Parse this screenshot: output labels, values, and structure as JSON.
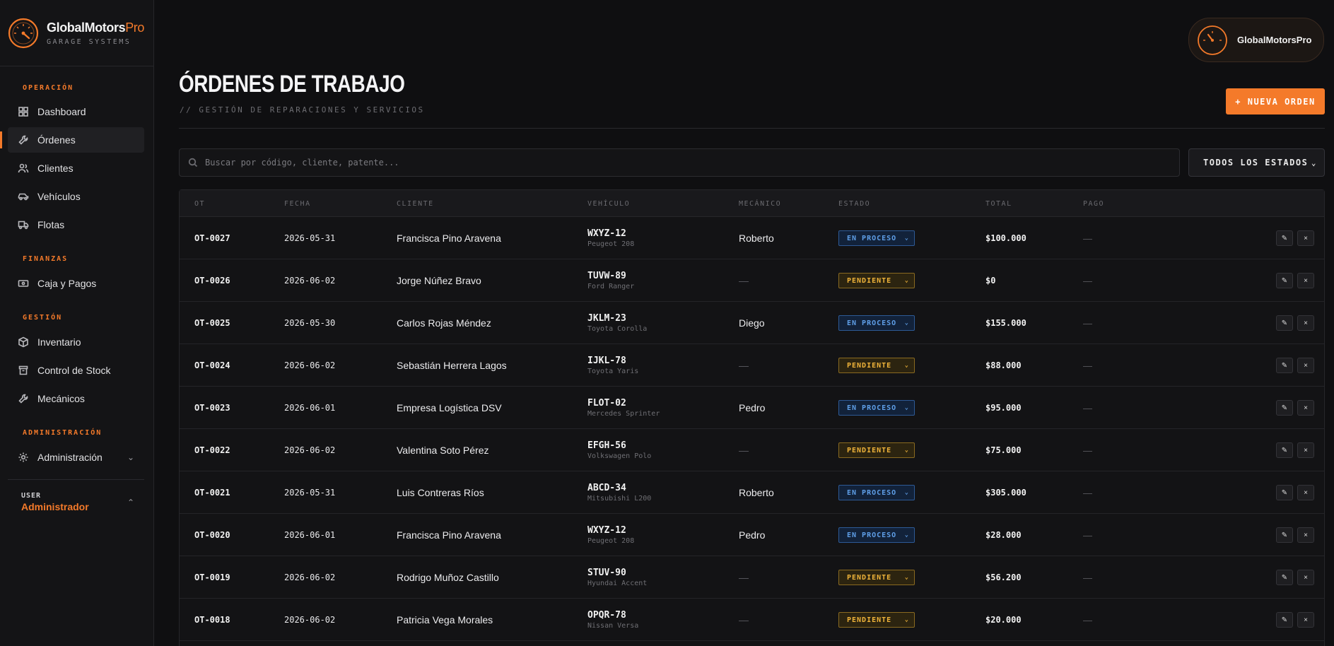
{
  "brand": {
    "name_main": "GlobalMotors",
    "name_accent": "Pro",
    "subtitle": "GARAGE SYSTEMS"
  },
  "sidebar": {
    "sections": {
      "operacion": "OPERACIÓN",
      "finanzas": "FINANZAS",
      "gestion": "GESTIÓN",
      "administracion": "ADMINISTRACIÓN"
    },
    "items": {
      "dashboard": "Dashboard",
      "ordenes": "Órdenes",
      "clientes": "Clientes",
      "vehiculos": "Vehículos",
      "flotas": "Flotas",
      "caja": "Caja y Pagos",
      "inventario": "Inventario",
      "stock": "Control de Stock",
      "mecanicos": "Mecánicos",
      "administracion": "Administración"
    },
    "user": {
      "label": "USER",
      "role": "Administrador"
    }
  },
  "topbar": {
    "profile_name": "GlobalMotorsPro"
  },
  "header": {
    "title": "ÓRDENES DE TRABAJO",
    "subtitle": "// GESTIÓN DE REPARACIONES Y SERVICIOS",
    "new_button": "+ NUEVA ORDEN"
  },
  "filters": {
    "search_placeholder": "Buscar por código, cliente, patente...",
    "status_select": "TODOS LOS ESTADOS"
  },
  "table": {
    "headers": {
      "ot": "OT",
      "fecha": "FECHA",
      "cliente": "CLIENTE",
      "vehiculo": "VEHÍCULO",
      "mecanico": "MECÁNICO",
      "estado": "ESTADO",
      "total": "TOTAL",
      "pago": "PAGO"
    },
    "rows": [
      {
        "ot": "OT-0027",
        "fecha": "2026-05-31",
        "cliente": "Francisca Pino Aravena",
        "patente": "WXYZ-12",
        "modelo": "Peugeot 208",
        "mecanico": "Roberto",
        "estado": "EN PROCESO",
        "total": "$100.000",
        "pago": "—"
      },
      {
        "ot": "OT-0026",
        "fecha": "2026-06-02",
        "cliente": "Jorge Núñez Bravo",
        "patente": "TUVW-89",
        "modelo": "Ford Ranger",
        "mecanico": "—",
        "estado": "PENDIENTE",
        "total": "$0",
        "pago": "—"
      },
      {
        "ot": "OT-0025",
        "fecha": "2026-05-30",
        "cliente": "Carlos Rojas Méndez",
        "patente": "JKLM-23",
        "modelo": "Toyota Corolla",
        "mecanico": "Diego",
        "estado": "EN PROCESO",
        "total": "$155.000",
        "pago": "—"
      },
      {
        "ot": "OT-0024",
        "fecha": "2026-06-02",
        "cliente": "Sebastián Herrera Lagos",
        "patente": "IJKL-78",
        "modelo": "Toyota Yaris",
        "mecanico": "—",
        "estado": "PENDIENTE",
        "total": "$88.000",
        "pago": "—"
      },
      {
        "ot": "OT-0023",
        "fecha": "2026-06-01",
        "cliente": "Empresa Logística DSV",
        "patente": "FLOT-02",
        "modelo": "Mercedes Sprinter",
        "mecanico": "Pedro",
        "estado": "EN PROCESO",
        "total": "$95.000",
        "pago": "—"
      },
      {
        "ot": "OT-0022",
        "fecha": "2026-06-02",
        "cliente": "Valentina Soto Pérez",
        "patente": "EFGH-56",
        "modelo": "Volkswagen Polo",
        "mecanico": "—",
        "estado": "PENDIENTE",
        "total": "$75.000",
        "pago": "—"
      },
      {
        "ot": "OT-0021",
        "fecha": "2026-05-31",
        "cliente": "Luis Contreras Ríos",
        "patente": "ABCD-34",
        "modelo": "Mitsubishi L200",
        "mecanico": "Roberto",
        "estado": "EN PROCESO",
        "total": "$305.000",
        "pago": "—"
      },
      {
        "ot": "OT-0020",
        "fecha": "2026-06-01",
        "cliente": "Francisca Pino Aravena",
        "patente": "WXYZ-12",
        "modelo": "Peugeot 208",
        "mecanico": "Pedro",
        "estado": "EN PROCESO",
        "total": "$28.000",
        "pago": "—"
      },
      {
        "ot": "OT-0019",
        "fecha": "2026-06-02",
        "cliente": "Rodrigo Muñoz Castillo",
        "patente": "STUV-90",
        "modelo": "Hyundai Accent",
        "mecanico": "—",
        "estado": "PENDIENTE",
        "total": "$56.200",
        "pago": "—"
      },
      {
        "ot": "OT-0018",
        "fecha": "2026-06-02",
        "cliente": "Patricia Vega Morales",
        "patente": "OPQR-78",
        "modelo": "Nissan Versa",
        "mecanico": "—",
        "estado": "PENDIENTE",
        "total": "$20.000",
        "pago": "—"
      }
    ],
    "action_labels": {
      "edit": "✎",
      "delete": "×"
    }
  },
  "colors": {
    "accent": "#f47a2a",
    "status_en_proceso": "#5f9fe8",
    "status_pendiente": "#f0b43a"
  },
  "icons": {
    "brand": "speedometer-gauge-icon",
    "dashboard": "grid-icon",
    "ordenes": "wrench-icon",
    "clientes": "users-icon",
    "vehiculos": "car-icon",
    "flotas": "truck-icon",
    "caja": "wallet-icon",
    "inventario": "box-icon",
    "stock": "bin-icon",
    "mecanicos": "wrench-icon",
    "administracion": "gear-icon",
    "search": "search-icon"
  }
}
